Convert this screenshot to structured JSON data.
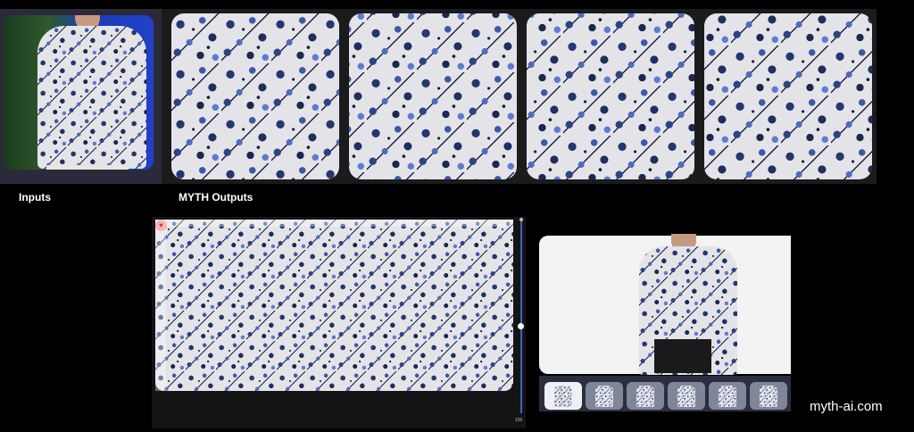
{
  "labels": {
    "inputs": "Inputs",
    "outputs": "MYTH Outputs"
  },
  "editor": {
    "zoom_label": "100"
  },
  "thumbnails": [
    {
      "name": "shirt-front",
      "active": true
    },
    {
      "name": "shirt-back",
      "active": false
    },
    {
      "name": "hoodie",
      "active": false
    },
    {
      "name": "tshirt",
      "active": false
    },
    {
      "name": "dress",
      "active": false
    },
    {
      "name": "shorts",
      "active": false
    }
  ],
  "footer": {
    "url": "myth-ai.com"
  },
  "colors": {
    "accent": "#3565c8",
    "panel": "#1b1b1b",
    "input_panel": "#2b2a3a",
    "thumb_bar": "#2a2e3e",
    "favorite": "#f4b6b6"
  }
}
